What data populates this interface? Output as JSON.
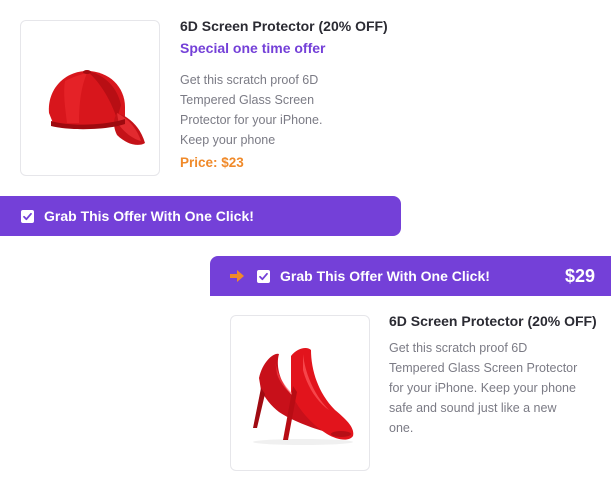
{
  "offer1": {
    "image_alt": "red baseball cap",
    "title": "6D Screen Protector (20% OFF)",
    "subtitle": "Special one time offer",
    "description": "Get this scratch proof 6D Tempered Glass Screen Protector for your iPhone. Keep your phone",
    "price": "Price: $23",
    "checkbox_label": "Grab This Offer With One Click!",
    "checked": true
  },
  "offer2": {
    "image_alt": "red high heel shoes",
    "title": "6D Screen Protector (20% OFF)",
    "description": "Get this scratch proof 6D Tempered Glass Screen Protector for your iPhone. Keep your phone safe and sound just like a new one.",
    "price": "$29",
    "checkbox_label": "Grab This Offer With One Click!",
    "checked": true,
    "arrow_icon": "arrow-right-icon"
  },
  "colors": {
    "accent": "#7440d8",
    "price": "#f08a2a",
    "product_red": "#d8161c"
  }
}
